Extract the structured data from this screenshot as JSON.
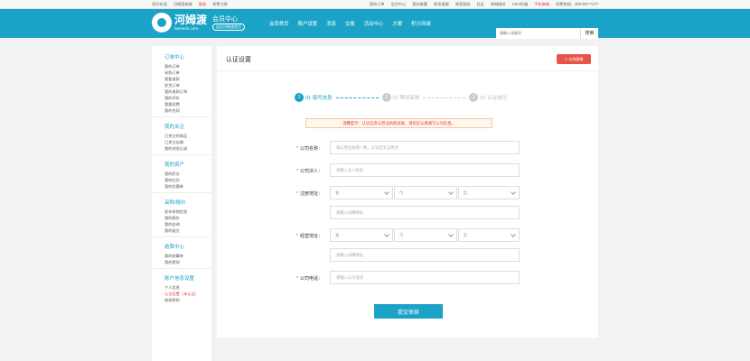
{
  "topbar": {
    "left": [
      "您好欢迎",
      "河姆渡商城",
      "登录",
      "免费注册"
    ],
    "right": [
      "我的订单",
      "会员中心",
      "我的收藏",
      "联系客服",
      "商家服务",
      "社区",
      "商城服务",
      "CEO信箱",
      "手机商城",
      "免费热线：400-807-7177"
    ]
  },
  "header": {
    "brand_cn": "河姆渡",
    "brand_en": "hemedu.com",
    "member_title": "会员中心",
    "member_sub": "返回河姆渡首页",
    "nav": [
      "会员首页",
      "账户设置",
      "消息",
      "交易",
      "活动中心",
      "方案",
      "积分商城"
    ],
    "search_placeholder": "请输入关键字",
    "search_btn": "搜索"
  },
  "sidebar": [
    {
      "title": "订单中心",
      "items": [
        "我的订单",
        "采购订单",
        "我要退款",
        "发货订单",
        "我的退款订单",
        "我的评价",
        "我要续费",
        "我的合同"
      ]
    },
    {
      "title": "我的关注",
      "items": [
        "已关注的商品",
        "已关注店铺",
        "我的浏览记录"
      ]
    },
    {
      "title": "我的资产",
      "items": [
        "我的积分",
        "我的红包",
        "我的优惠券"
      ]
    },
    {
      "title": "采购/报价",
      "items": [
        "发布采购信息",
        "我的报价",
        "我的咨询",
        "我的留言"
      ]
    },
    {
      "title": "结算中心",
      "items": [
        "我的结算单",
        "我的提现"
      ]
    },
    {
      "title": "账户信息设置",
      "items": [
        "个人信息",
        "认证设置（未认证）",
        "修改密码"
      ]
    }
  ],
  "main": {
    "title": "认证设置",
    "online_btn": "在线客服",
    "steps": [
      {
        "num": "1",
        "label": "01 填写信息"
      },
      {
        "num": "2",
        "label": "02 等待审核"
      },
      {
        "num": "3",
        "label": "03 认证成功"
      }
    ],
    "notice": "温馨提示：认证信息与营业执照关联，请如实认真填写公司信息。",
    "fields": {
      "company_name": {
        "label": "公司名称：",
        "placeholder": "请与营业执照一致，认证后无法更改"
      },
      "legal_person": {
        "label": "公司法人：",
        "placeholder": "请输入法人姓名"
      },
      "reg_address": {
        "label": "注册地址：",
        "selects": [
          "省",
          "市",
          "区"
        ],
        "placeholder": "请输入详细地址"
      },
      "biz_address": {
        "label": "经营地址：",
        "selects": [
          "省",
          "市",
          "区"
        ],
        "placeholder": "请输入详细地址"
      },
      "phone": {
        "label": "公司电话：",
        "placeholder": "请输入公司电话"
      }
    },
    "submit": "提交审核"
  }
}
